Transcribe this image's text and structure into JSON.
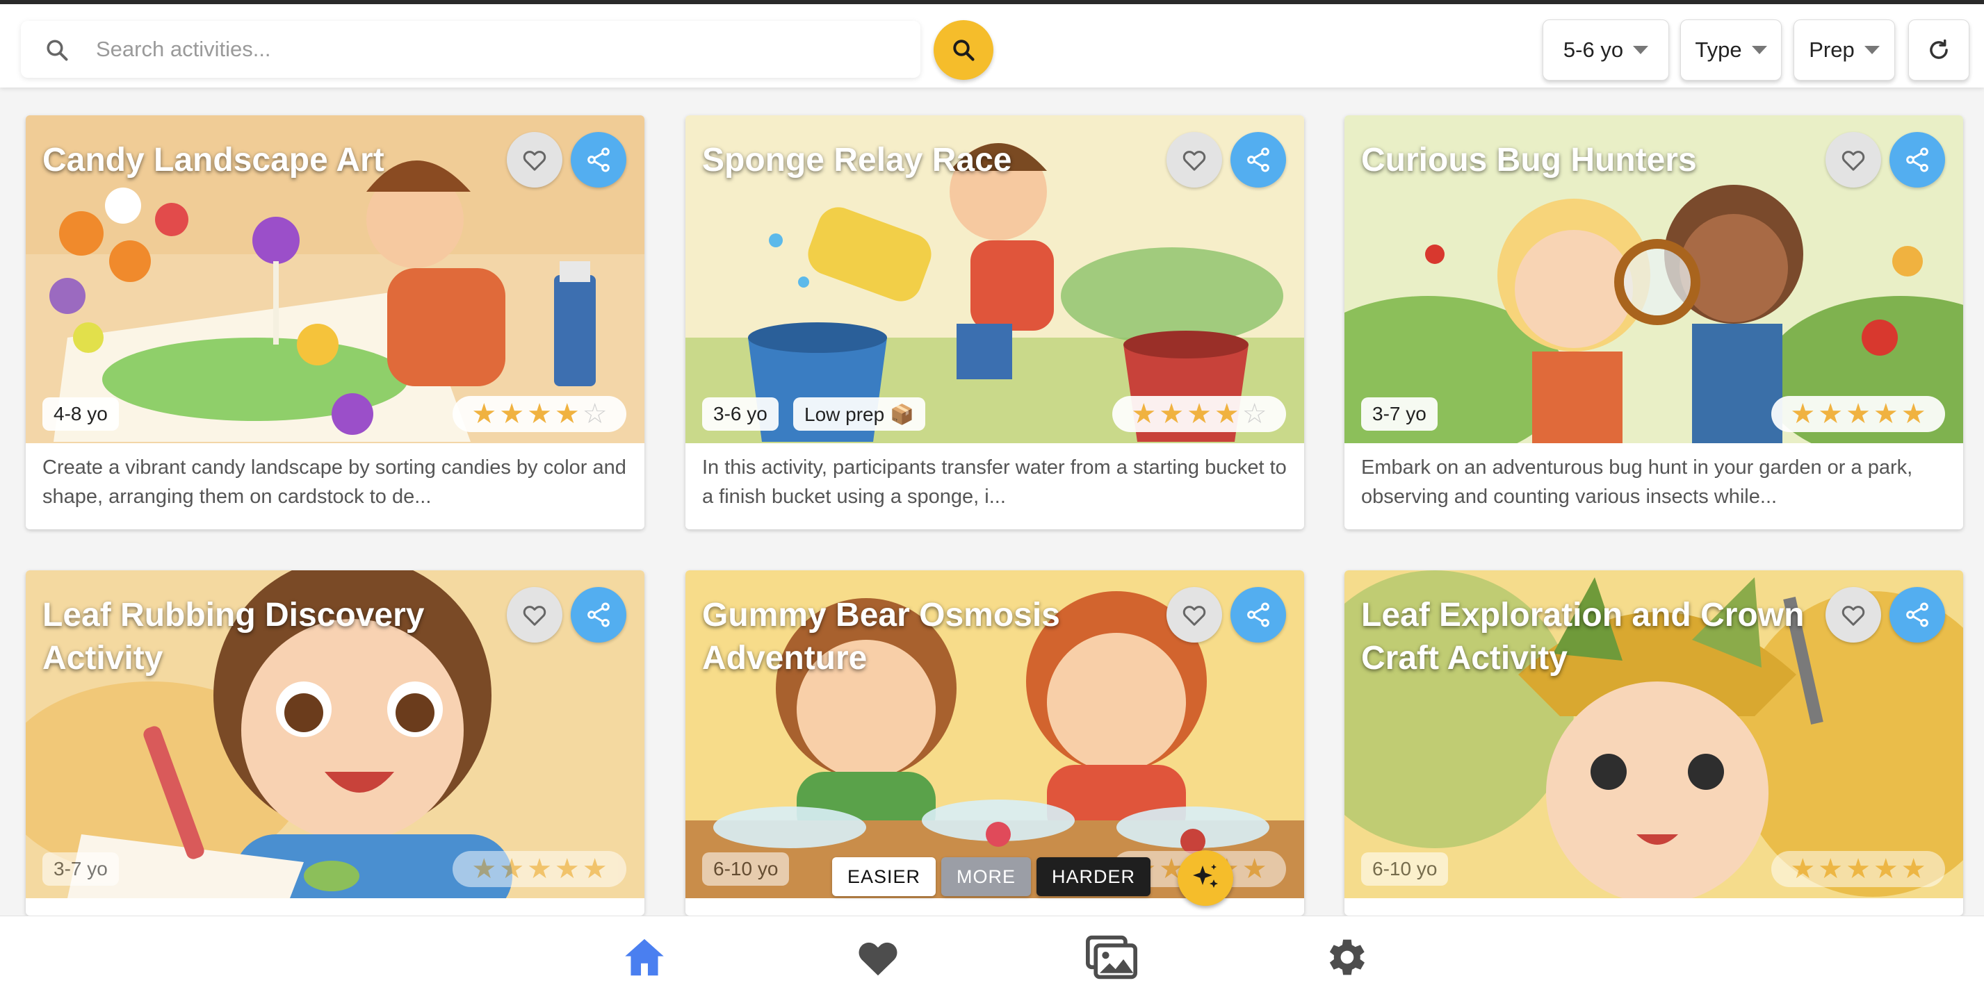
{
  "search": {
    "placeholder": "Search activities..."
  },
  "filters": {
    "age": "5-6 yo",
    "type": "Type",
    "prep": "Prep"
  },
  "cards": [
    {
      "title": "Candy Landscape Art",
      "age": "4-8 yo",
      "prep": "",
      "rating": 4,
      "description": "Create a vibrant candy landscape by sorting candies by color and shape, arranging them on cardstock to de..."
    },
    {
      "title": "Sponge Relay Race",
      "age": "3-6 yo",
      "prep": "Low prep 📦",
      "rating": 4,
      "description": "In this activity, participants transfer water from a starting bucket to a finish bucket using a sponge, i..."
    },
    {
      "title": "Curious Bug Hunters",
      "age": "3-7 yo",
      "prep": "",
      "rating": 5,
      "description": "Embark on an adventurous bug hunt in your garden or a park, observing and counting various insects while..."
    },
    {
      "title": "Leaf Rubbing Discovery Activity",
      "age": "3-7 yo",
      "prep": "",
      "rating": 5,
      "description": ""
    },
    {
      "title": "Gummy Bear Osmosis Adventure",
      "age": "6-10 yo",
      "prep": "",
      "rating": 5,
      "description": ""
    },
    {
      "title": "Leaf Exploration and Crown Craft Activity",
      "age": "6-10 yo",
      "prep": "",
      "rating": 5,
      "description": ""
    }
  ],
  "difficulty": {
    "easier": "EASIER",
    "more": "MORE",
    "harder": "HARDER"
  },
  "icons": {
    "search": "search-icon",
    "refresh": "refresh-icon",
    "heart": "heart-icon",
    "share": "share-icon",
    "star": "star-icon",
    "sparkle": "sparkle-icon",
    "home": "home-icon",
    "favorites": "heart-icon",
    "gallery": "gallery-icon",
    "settings": "gear-icon"
  },
  "colors": {
    "accent": "#f5bd2b",
    "share": "#53aef0",
    "nav_active": "#4a7ff0",
    "nav_inactive": "#4d4d4d",
    "star": "#f0b240"
  }
}
